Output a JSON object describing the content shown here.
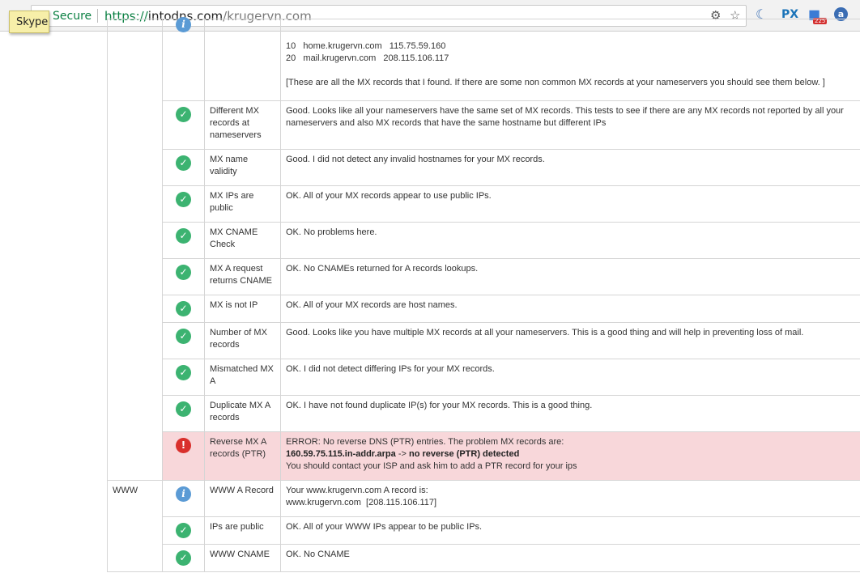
{
  "browser": {
    "secure_label": "Secure",
    "url_scheme": "https://",
    "url_host": "intodns.com",
    "url_path": "/krugervn.com",
    "ext_px_label": "PX",
    "ext_badge": "225",
    "tooltip": "Skype"
  },
  "mx_list": {
    "line1": "10   home.krugervn.com   115.75.59.160",
    "line2": "20   mail.krugervn.com   208.115.106.117",
    "note": "[These are all the MX records that I found. If there are some non common MX records at your nameservers you should see them below. ]"
  },
  "rows": [
    {
      "test": "Different MX records at nameservers",
      "info": "Good. Looks like all your nameservers have the same set of MX records. This tests to see if there are any MX records not reported by all your nameservers and also MX records that have the same hostname but different IPs"
    },
    {
      "test": "MX name validity",
      "info": "Good. I did not detect any invalid hostnames for your MX records."
    },
    {
      "test": "MX IPs are public",
      "info": "OK. All of your MX records appear to use public IPs."
    },
    {
      "test": "MX CNAME Check",
      "info": "OK. No problems here."
    },
    {
      "test": "MX A request returns CNAME",
      "info": "OK. No CNAMEs returned for A records lookups."
    },
    {
      "test": "MX is not IP",
      "info": "OK. All of your MX records are host names."
    },
    {
      "test": "Number of MX records",
      "info": "Good. Looks like you have multiple MX records at all your nameservers. This is a good thing and will help in preventing loss of mail."
    },
    {
      "test": "Mismatched MX A",
      "info": "OK. I did not detect differing IPs for your MX records."
    },
    {
      "test": "Duplicate MX A records",
      "info": "OK. I have not found duplicate IP(s) for your MX records. This is a good thing."
    }
  ],
  "error_row": {
    "test": "Reverse MX A records (PTR)",
    "line1": "ERROR: No reverse DNS (PTR) entries. The problem MX records are:",
    "arpa": "160.59.75.115.in-addr.arpa",
    "arrow": " -> ",
    "detected": "no reverse (PTR) detected",
    "line3": "You should contact your ISP and ask him to add a PTR record for your ips"
  },
  "www": {
    "category": "WWW",
    "a_record_test": "WWW A Record",
    "a_record_line1": "Your www.krugervn.com A record is:",
    "a_record_line2": "www.krugervn.com  [208.115.106.117]",
    "public_test": "IPs are public",
    "public_info": "OK. All of your WWW IPs appear to be public IPs.",
    "cname_test": "WWW CNAME",
    "cname_info": "OK. No CNAME"
  },
  "colors": {
    "ok": "#3cb371",
    "info": "#5b9bd5",
    "error": "#d9302c",
    "error_bg": "#f8d7da"
  }
}
